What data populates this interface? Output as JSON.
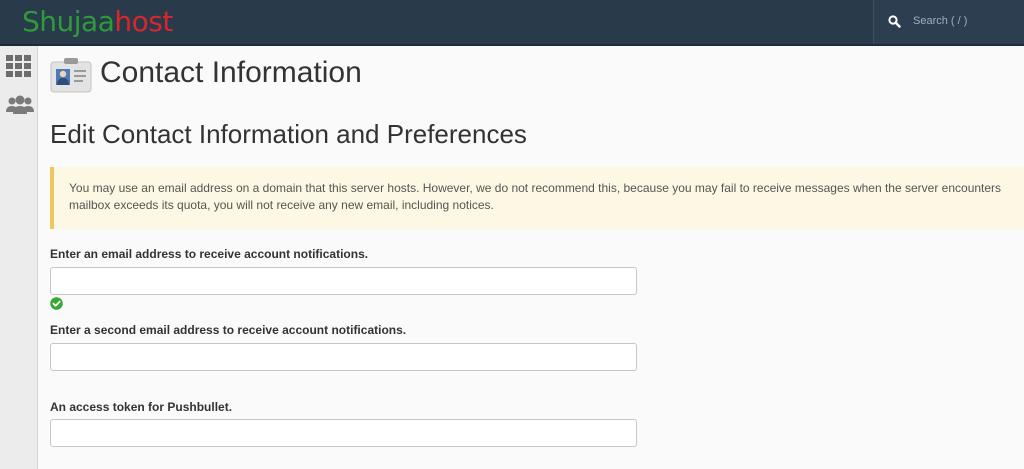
{
  "header": {
    "brand_part1": "Shujaa",
    "brand_part2": "host",
    "search_label": "Search ( / )"
  },
  "sidebar": {
    "items": [
      {
        "icon": "grid-icon"
      },
      {
        "icon": "users-icon"
      }
    ]
  },
  "page": {
    "title": "Contact Information",
    "section_title": "Edit Contact Information and Preferences"
  },
  "alert": {
    "line1": "You may use an email address on a domain that this server hosts. However, we do not recommend this, because you may fail to receive messages when the server encounters",
    "line2": "mailbox exceeds its quota, you will not receive any new email, including notices."
  },
  "form": {
    "email1_label": "Enter an email address to receive account notifications.",
    "email1_value": "",
    "email1_status": "valid",
    "email2_label": "Enter a second email address to receive account notifications.",
    "email2_value": "",
    "pushbullet_label": "An access token for Pushbullet.",
    "pushbullet_value": ""
  },
  "colors": {
    "topbar": "#293a4a",
    "brand_green": "#2e9b3a",
    "brand_red": "#d8262b",
    "alert_bg": "#fcf8e3",
    "alert_border": "#f0c75c",
    "success_green": "#3aa835"
  }
}
